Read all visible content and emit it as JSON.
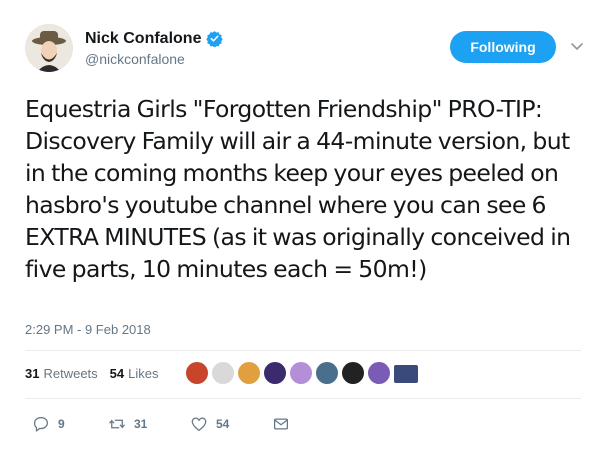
{
  "author": {
    "display_name": "Nick Confalone",
    "handle": "@nickconfalone"
  },
  "follow_button": {
    "label": "Following"
  },
  "tweet": {
    "text": "Equestria Girls \"Forgotten Friendship\" PRO-TIP: Discovery Family will air a 44-minute version, but in the coming months keep your eyes peeled on hasbro's youtube channel where you can see 6 EXTRA MINUTES (as it was originally conceived in five parts, 10 minutes each = 50m!)",
    "timestamp": "2:29 PM - 9 Feb 2018"
  },
  "stats": {
    "retweets_count": "31",
    "retweets_label": "Retweets",
    "likes_count": "54",
    "likes_label": "Likes"
  },
  "liker_avatars": [
    {
      "color": "#c8452c"
    },
    {
      "color": "#d9d9d9"
    },
    {
      "color": "#e0a040"
    },
    {
      "color": "#3b2b6e"
    },
    {
      "color": "#b48fd8"
    },
    {
      "color": "#4a6f8c"
    },
    {
      "color": "#222222"
    },
    {
      "color": "#7a5bb5"
    },
    {
      "color": "#3a4a7a"
    }
  ],
  "actions": {
    "reply_count": "9",
    "retweet_count": "31",
    "like_count": "54"
  },
  "colors": {
    "accent": "#1da1f2",
    "secondary_text": "#657786",
    "divider": "#e6ecf0"
  }
}
